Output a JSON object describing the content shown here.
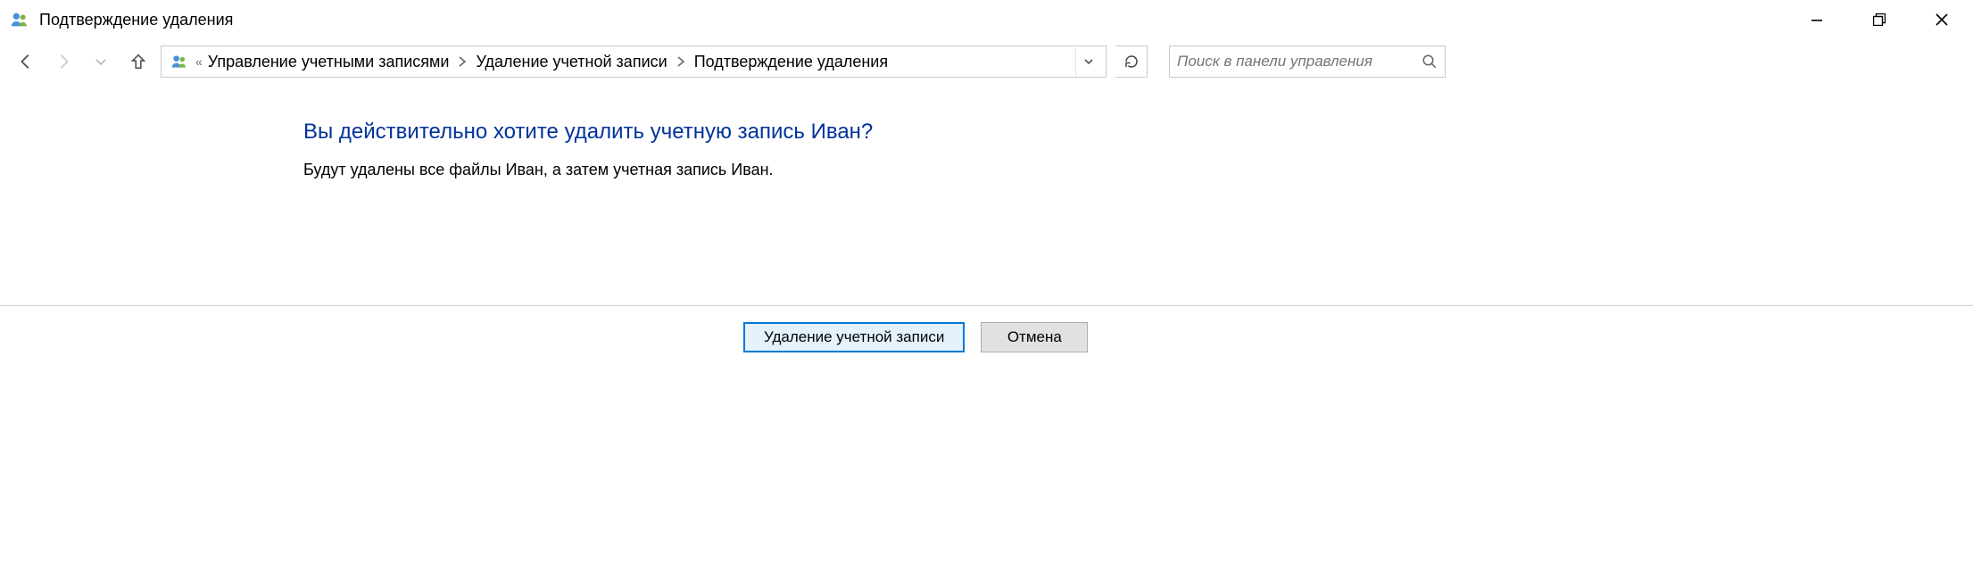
{
  "titlebar": {
    "title": "Подтверждение удаления"
  },
  "navigation": {
    "breadcrumb_overflow": "«",
    "breadcrumbs": [
      "Управление учетными записями",
      "Удаление учетной записи",
      "Подтверждение удаления"
    ]
  },
  "search": {
    "placeholder": "Поиск в панели управления"
  },
  "main": {
    "heading": "Вы действительно хотите удалить учетную запись Иван?",
    "body": "Будут удалены все файлы Иван, а затем учетная запись Иван."
  },
  "buttons": {
    "delete_account": "Удаление учетной записи",
    "cancel": "Отмена"
  }
}
